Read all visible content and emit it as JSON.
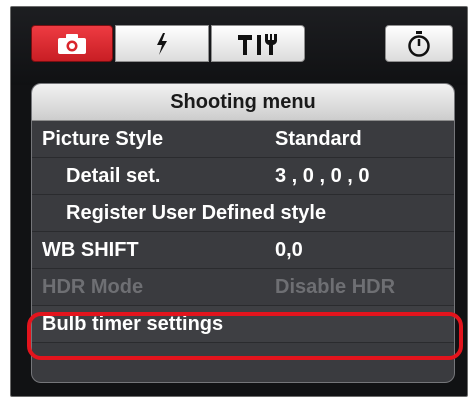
{
  "tabs": {
    "shooting_icon": "camera-icon",
    "flash_icon": "flash-icon",
    "tools_icon": "tools-icon",
    "timer_icon": "timer-icon"
  },
  "menu": {
    "title": "Shooting menu",
    "items": [
      {
        "label": "Picture Style",
        "value": "Standard",
        "enabled": true
      },
      {
        "label": "Detail set.",
        "value": "3 , 0 , 0 , 0",
        "enabled": true
      },
      {
        "label": "Register User Defined style",
        "value": "",
        "enabled": true
      },
      {
        "label": "WB SHIFT",
        "value": "0,0",
        "enabled": true
      },
      {
        "label": "HDR Mode",
        "value": "Disable HDR",
        "enabled": false
      },
      {
        "label": "Bulb timer settings",
        "value": "",
        "enabled": true,
        "highlighted": true
      }
    ]
  },
  "colors": {
    "shoot_tab": "#d9252c",
    "highlight_ring": "#e3141d",
    "panel_bg": "#3a3b3f"
  }
}
